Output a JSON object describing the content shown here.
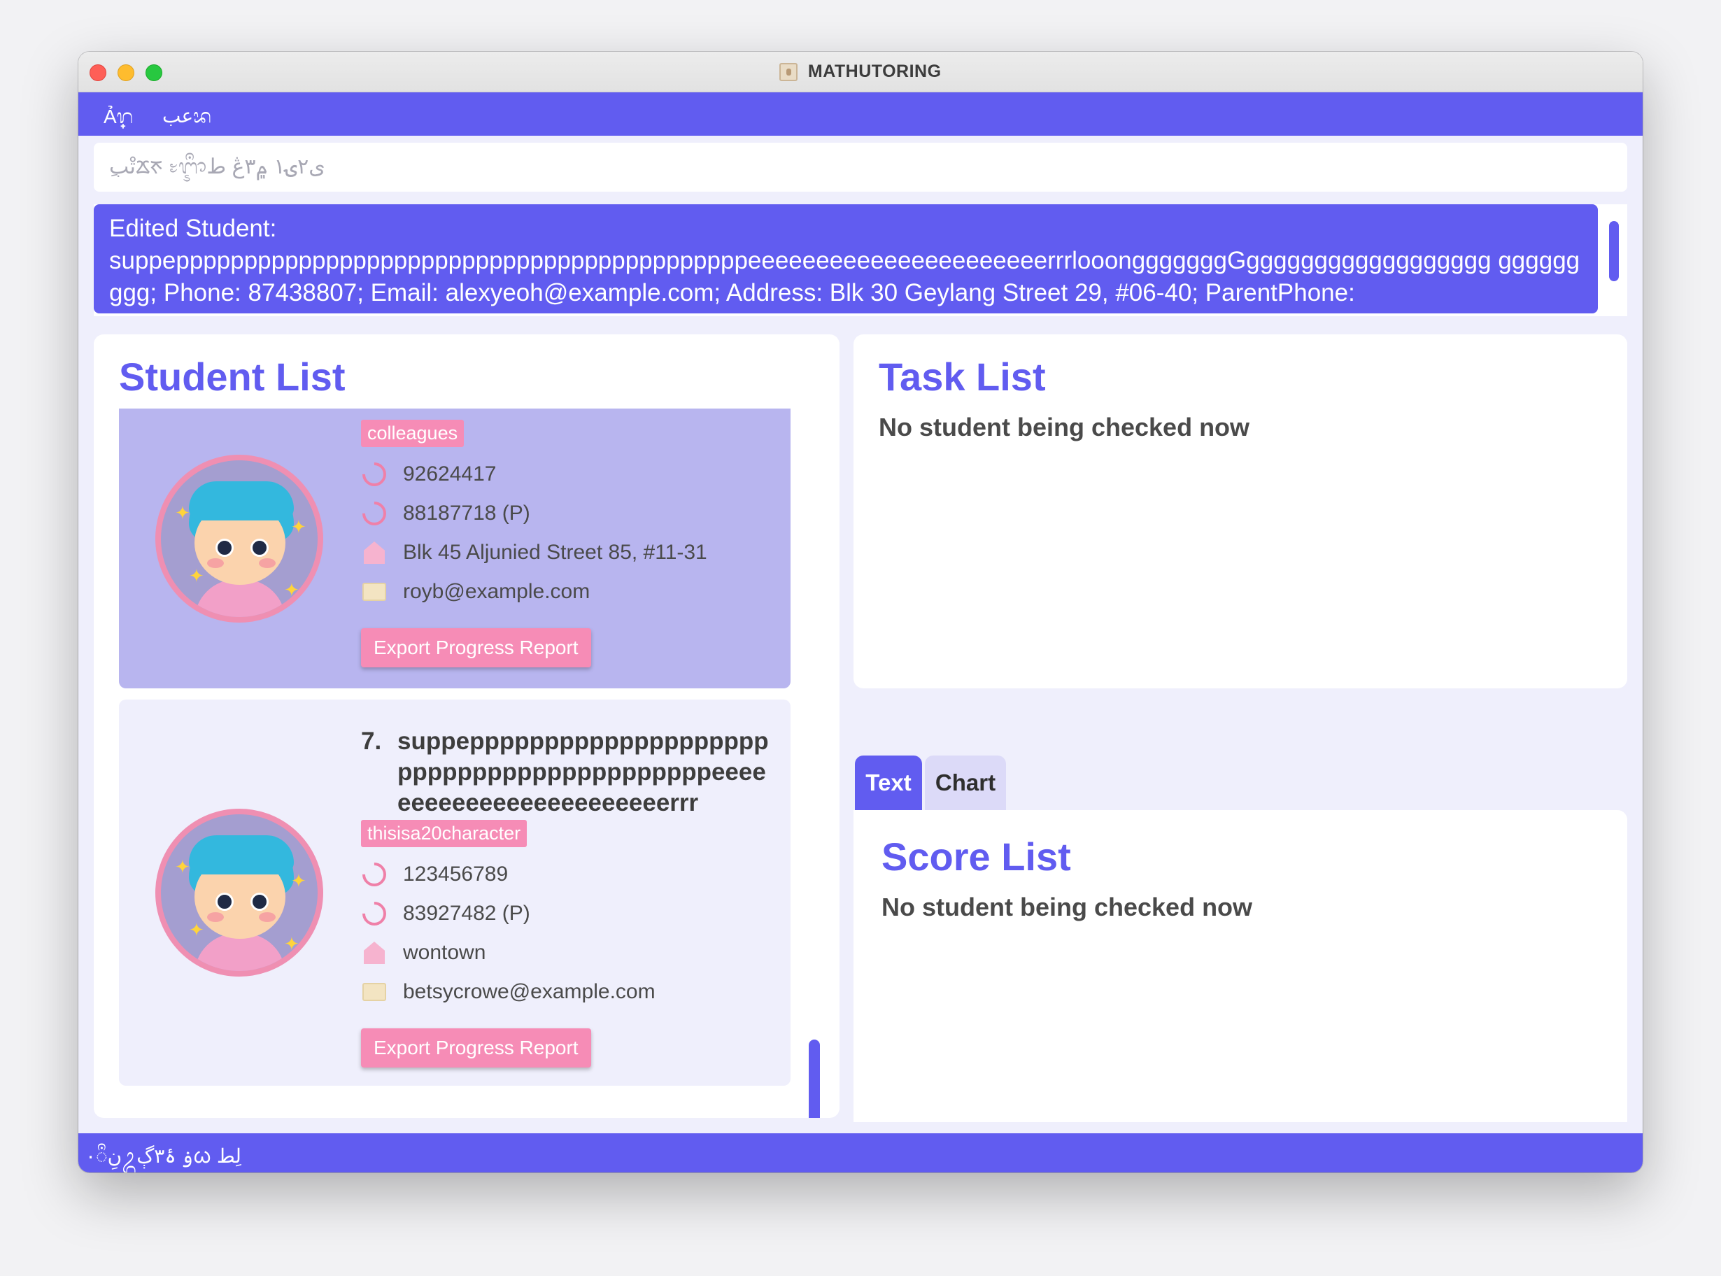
{
  "window": {
    "title": "MATHUTORING"
  },
  "menu": {
    "items": [
      "Ả᩠ᬭ",
      "عبᬪ"
    ]
  },
  "command": {
    "placeholder": "ِتْبᰇᰉ ᭝ᬈᬀط ‎ی۲ۍ۱ ۾۳ڠ"
  },
  "result": {
    "text": "Edited Student:\nsuppeppppppppppppppppppppppppppppppppppppppppppeeeeeeeeeeeeeeeeeeeeeerrrlooongggggggGgggggggggggggggggg ggggggggg; Phone: 87438807; Email: alexyeoh@example.com; Address: Blk 30 Geylang Street 29, #06-40; ParentPhone:"
  },
  "students": {
    "title": "Student List",
    "cards": [
      {
        "tag": "colleagues",
        "phone": "92624417",
        "parent_phone": "88187718 (P)",
        "address": "Blk 45 Aljunied Street 85, #11-31",
        "email": "royb@example.com",
        "export_label": "Export Progress Report"
      },
      {
        "index": "7.",
        "name": "suppepppppppppppppppppppppppppppppppppppppppppeeeeeeeeeeeeeeeeeeeeeeeerrr",
        "tag": "thisisa20character",
        "phone": "123456789",
        "parent_phone": "83927482 (P)",
        "address": "wontown",
        "email": "betsycrowe@example.com",
        "export_label": "Export Progress Report"
      }
    ]
  },
  "tasks": {
    "title": "Task List",
    "message": "No student being checked now"
  },
  "tabs": {
    "text": "Text",
    "chart": "Chart"
  },
  "scores": {
    "title": "Score List",
    "message": "No student being checked now"
  },
  "status": {
    "text": "۰نِᬀᬉۂ۳ڳ ‎ۏᰃ لِط"
  },
  "colors": {
    "accent": "#615cf0",
    "tag_pink": "#f68cb6",
    "selected_card": "#b8b5ef",
    "card_bg": "#efeffc"
  }
}
